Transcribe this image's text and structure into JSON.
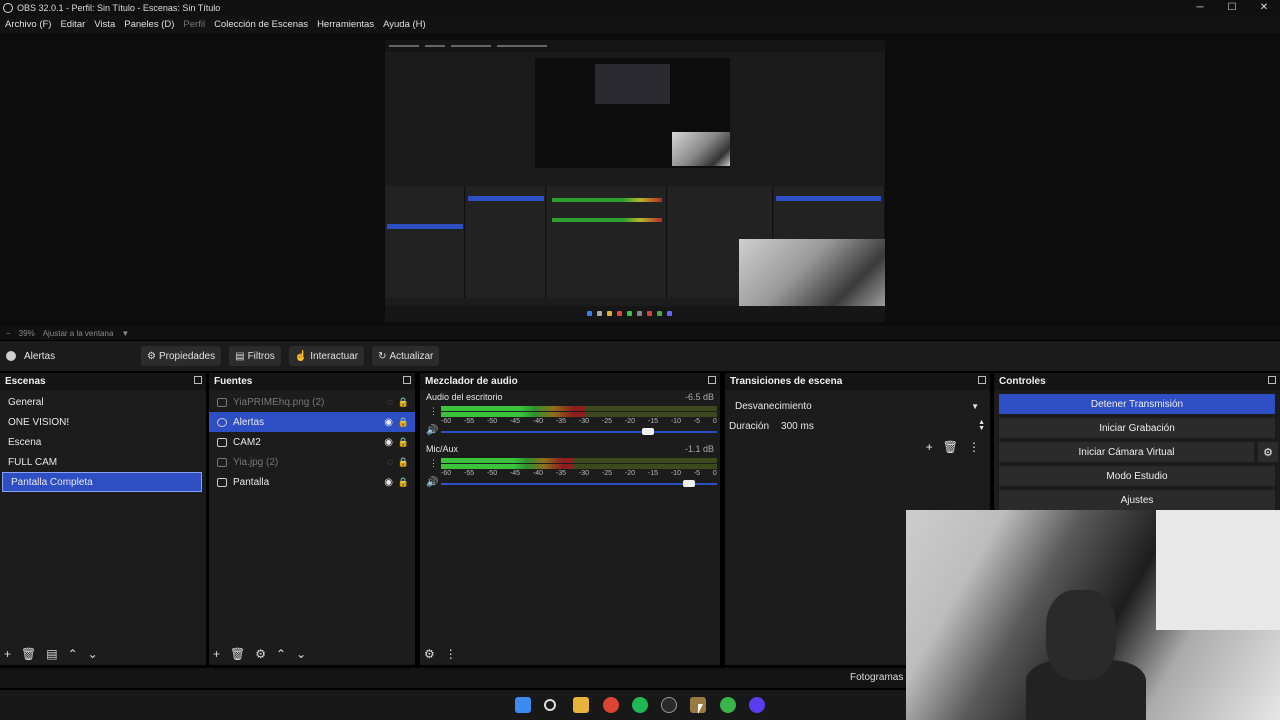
{
  "window": {
    "title": "OBS 32.0.1 - Perfil: Sin Título - Escenas: Sin Título"
  },
  "menu": [
    "Archivo (F)",
    "Editar",
    "Vista",
    "Paneles (D)",
    "Perfil",
    "Colección de Escenas",
    "Herramientas",
    "Ayuda (H)"
  ],
  "menu_disabled_index": 4,
  "zoom": {
    "minus": "−",
    "level": "39%",
    "fit_label": "Ajustar a la ventana"
  },
  "source_toolbar": {
    "current_source": "Alertas",
    "properties": "Propiedades",
    "filters": "Filtros",
    "interact": "Interactuar",
    "refresh": "Actualizar"
  },
  "scenes": {
    "title": "Escenas",
    "items": [
      "General",
      "ONE VISION!",
      "Escena",
      "FULL CAM",
      "Pantalla Completa"
    ],
    "selected": "Pantalla Completa"
  },
  "sources": {
    "title": "Fuentes",
    "items": [
      {
        "name": "YiaPRIMEhq.png (2)",
        "visible": false
      },
      {
        "name": "Alertas",
        "visible": true
      },
      {
        "name": "CAM2",
        "visible": true
      },
      {
        "name": "Yia.jpg (2)",
        "visible": false
      },
      {
        "name": "Pantalla",
        "visible": true
      }
    ],
    "selected": "Alertas"
  },
  "mixer": {
    "title": "Mezclador de audio",
    "channels": [
      {
        "name": "Audio del escritorio",
        "db": "-6.5 dB",
        "level": 0.52,
        "fader": 0.75
      },
      {
        "name": "Mic/Aux",
        "db": "-1.1 dB",
        "level": 0.48,
        "fader": 0.9
      }
    ],
    "ticks": [
      "-60",
      "-55",
      "-50",
      "-45",
      "-40",
      "-35",
      "-30",
      "-25",
      "-20",
      "-15",
      "-10",
      "-5",
      "0"
    ]
  },
  "transitions": {
    "title": "Transiciones de escena",
    "selected": "Desvanecimiento",
    "duration_label": "Duración",
    "duration_value": "300 ms"
  },
  "controls": {
    "title": "Controles",
    "stop_stream": "Detener Transmisión",
    "start_recording": "Iniciar Grabación",
    "start_virtual_cam": "Iniciar Cámara Virtual",
    "studio_mode": "Modo Estudio",
    "settings": "Ajustes"
  },
  "status": {
    "frames": "Fotogramas Pe"
  },
  "colors": {
    "accent": "#2e4fc4",
    "panel": "#1c1c1c",
    "header": "#141414"
  }
}
